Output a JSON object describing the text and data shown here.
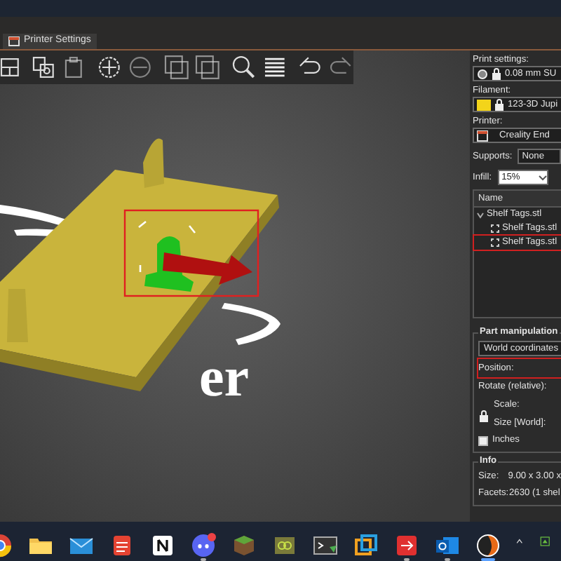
{
  "window_tab": {
    "label": "Printer Settings"
  },
  "viewport": {
    "bed_logo_text": "er",
    "selection_box": true
  },
  "print_settings": {
    "label": "Print settings:",
    "value": "0.08 mm SU"
  },
  "filament": {
    "label": "Filament:",
    "value": "123-3D Jupi"
  },
  "printer": {
    "label": "Printer:",
    "value": "Creality End"
  },
  "supports": {
    "label": "Supports:",
    "value": "None"
  },
  "infill": {
    "label": "Infill:",
    "value": "15%"
  },
  "object_list": {
    "header": "Name",
    "items": [
      {
        "label": "Shelf Tags.stl",
        "expanded": true,
        "highlighted": false,
        "children": [
          {
            "label": "Shelf Tags.stl",
            "highlighted": false
          },
          {
            "label": "Shelf Tags.stl",
            "highlighted": true
          }
        ]
      }
    ]
  },
  "part_manipulation": {
    "title": "Part manipulation",
    "coordinates": "World coordinates",
    "rows": [
      {
        "label": "Position:",
        "highlighted": true
      },
      {
        "label": "Rotate (relative):",
        "highlighted": false
      },
      {
        "label": "Scale:",
        "highlighted": false
      },
      {
        "label": "Size [World]:",
        "highlighted": false
      }
    ],
    "inches": {
      "label": "Inches",
      "checked": false
    }
  },
  "info": {
    "title": "Info",
    "rows": [
      {
        "label": "Size:",
        "value": "9.00 x 3.00 x"
      },
      {
        "label": "Facets:",
        "value": "2630 (1 shel"
      }
    ]
  },
  "taskbar": {
    "apps": [
      {
        "kind": "chrome",
        "running": false,
        "active": false
      },
      {
        "kind": "folder",
        "running": false,
        "active": false
      },
      {
        "kind": "mail",
        "running": false,
        "active": false
      },
      {
        "kind": "todo",
        "running": false,
        "active": false
      },
      {
        "kind": "notion",
        "running": false,
        "active": false
      },
      {
        "kind": "discord",
        "running": true,
        "active": false
      },
      {
        "kind": "block",
        "running": false,
        "active": false
      },
      {
        "kind": "box",
        "running": false,
        "active": false
      },
      {
        "kind": "terminal",
        "running": false,
        "active": false
      },
      {
        "kind": "squares",
        "running": false,
        "active": false
      },
      {
        "kind": "remote",
        "running": true,
        "active": false
      },
      {
        "kind": "outlook",
        "running": true,
        "active": false
      },
      {
        "kind": "slicer",
        "running": true,
        "active": true
      }
    ]
  }
}
